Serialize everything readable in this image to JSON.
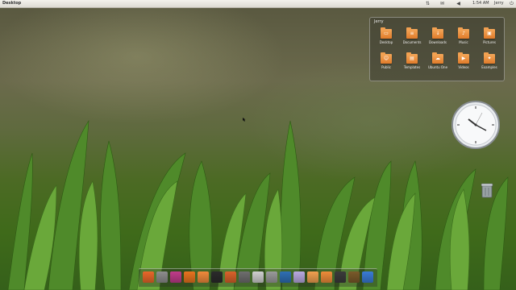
{
  "panel": {
    "title": "Desktop",
    "time": "1:54 AM",
    "user": "Jerry"
  },
  "stack": {
    "title": "Jerry",
    "folders": [
      {
        "label": "Desktop",
        "icon": "desktop-icon"
      },
      {
        "label": "Documents",
        "icon": "documents-icon"
      },
      {
        "label": "Downloads",
        "icon": "downloads-icon"
      },
      {
        "label": "Music",
        "icon": "music-icon"
      },
      {
        "label": "Pictures",
        "icon": "pictures-icon"
      },
      {
        "label": "Public",
        "icon": "public-icon"
      },
      {
        "label": "Templates",
        "icon": "templates-icon"
      },
      {
        "label": "Ubuntu One",
        "icon": "ubuntu-one-icon"
      },
      {
        "label": "Videos",
        "icon": "videos-icon"
      },
      {
        "label": "Examples",
        "icon": "examples-icon"
      }
    ]
  },
  "dock": {
    "items": [
      {
        "name": "ubuntu-icon",
        "color": "#e9672a"
      },
      {
        "name": "system-monitor-icon",
        "color": "#8d8d8d"
      },
      {
        "name": "media-player-icon",
        "color": "#c03c8a"
      },
      {
        "name": "firefox-icon",
        "color": "#e8731f"
      },
      {
        "name": "home-folder-icon",
        "color": "#f08a3c"
      },
      {
        "name": "terminal-icon",
        "color": "#2b2b2b"
      },
      {
        "name": "software-center-icon",
        "color": "#d9622b"
      },
      {
        "name": "settings-icon",
        "color": "#6e6e6e"
      },
      {
        "name": "text-editor-icon",
        "color": "#cfcfcf"
      },
      {
        "name": "calculator-icon",
        "color": "#9a9a9a"
      },
      {
        "name": "thunderbird-icon",
        "color": "#2f6fb3"
      },
      {
        "name": "pidgin-icon",
        "color": "#b8a9e0"
      },
      {
        "name": "documents-stack-icon",
        "color": "#f0a050"
      },
      {
        "name": "downloads-stack-icon",
        "color": "#ee8c3a"
      },
      {
        "name": "phone-icon",
        "color": "#3b3b3b"
      },
      {
        "name": "palette-icon",
        "color": "#7a5a2a"
      },
      {
        "name": "accessibility-icon",
        "color": "#3a7bd5"
      }
    ]
  }
}
